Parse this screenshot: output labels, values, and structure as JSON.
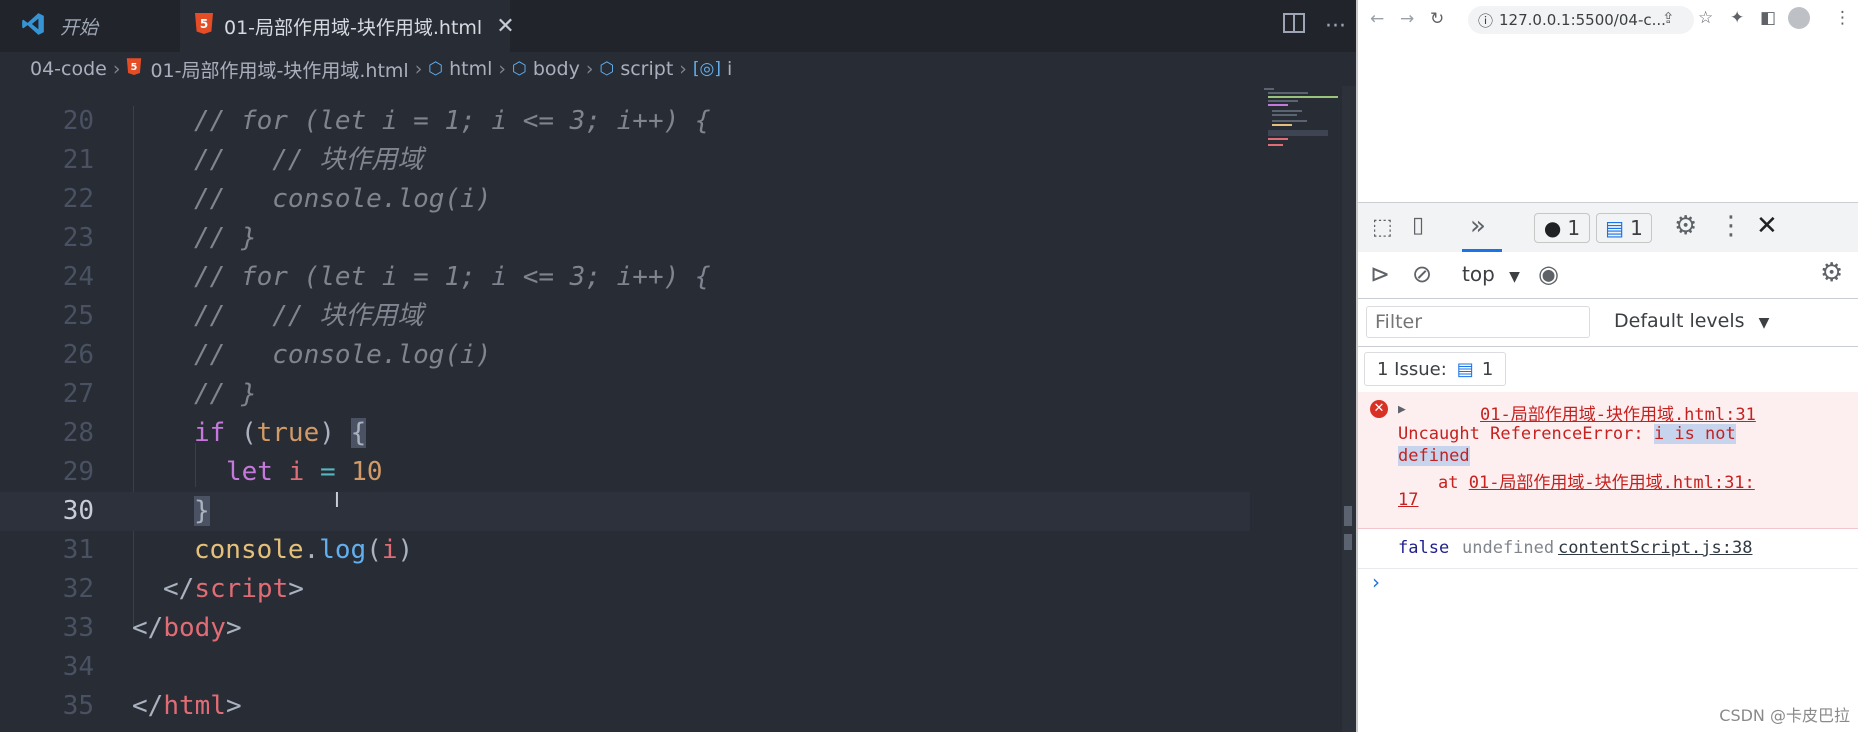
{
  "vscode": {
    "tabs": [
      {
        "label": "开始"
      },
      {
        "label": "01-局部作用域-块作用域.html"
      }
    ],
    "breadcrumb": [
      "04-code",
      "01-局部作用域-块作用域.html",
      "html",
      "body",
      "script",
      "i"
    ],
    "lines": [
      {
        "num": "20",
        "code": "// for (let i = 1; i <= 3; i++) {"
      },
      {
        "num": "21",
        "code": "//   // 块作用域"
      },
      {
        "num": "22",
        "code": "//   console.log(i)"
      },
      {
        "num": "23",
        "code": "// }"
      },
      {
        "num": "24",
        "code": "// for (let i = 1; i <= 3; i++) {"
      },
      {
        "num": "25",
        "code": "//   // 块作用域"
      },
      {
        "num": "26",
        "code": "//   console.log(i)"
      },
      {
        "num": "27",
        "code": "// }"
      },
      {
        "num": "28",
        "parts": [
          "if",
          " (",
          "true",
          ") ",
          "{"
        ]
      },
      {
        "num": "29",
        "parts": [
          "let",
          " i ",
          "=",
          " ",
          "10"
        ]
      },
      {
        "num": "30",
        "parts": [
          "}"
        ]
      },
      {
        "num": "31",
        "parts": [
          "console",
          ".",
          "log",
          "(",
          "i",
          ")"
        ]
      },
      {
        "num": "32",
        "parts": [
          "</",
          "script",
          ">"
        ]
      },
      {
        "num": "33",
        "parts": [
          "</",
          "body",
          ">"
        ]
      },
      {
        "num": "34",
        "parts": []
      },
      {
        "num": "35",
        "parts": [
          "</",
          "html",
          ">"
        ]
      }
    ]
  },
  "browser": {
    "url": "127.0.0.1:5500/04-c...",
    "devtools": {
      "errors_count": "1",
      "issues_count": "1",
      "context": "top",
      "filter_placeholder": "Filter",
      "levels": "Default levels",
      "issues_label": "1 Issue:",
      "issues_badge": "1"
    },
    "error": {
      "source": "01-局部作用域-块作用域.html:31",
      "message_prefix": "Uncaught ReferenceError: ",
      "message_highlight_1": "i is not",
      "message_highlight_2": "defined",
      "at_label": "at ",
      "at_source": "01-局部作用域-块作用域.html:31:",
      "at_col": "17"
    },
    "log": {
      "value1": "false",
      "value2": "undefined",
      "source": "contentScript.js:38"
    },
    "watermark": "CSDN @卡皮巴拉"
  },
  "colors": {
    "editor_bg": "#282c34",
    "error_bg": "#fdeef0",
    "error_text": "#c5221f",
    "link_blue": "#1a73e8"
  }
}
